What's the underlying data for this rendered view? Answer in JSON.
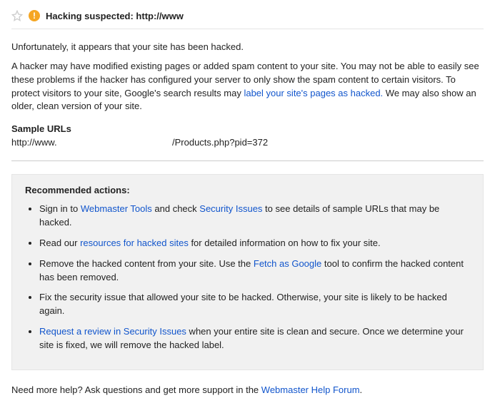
{
  "header": {
    "title": "Hacking suspected: http://www"
  },
  "intro": "Unfortunately, it appears that your site has been hacked.",
  "body": {
    "part1": "A hacker may have modified existing pages or added spam content to your site. You may not be able to easily see these problems if the hacker has configured your server to only show the spam content to certain visitors. To protect visitors to your site, Google's search results may ",
    "link1": "label your site's pages as hacked.",
    "part2": " We may also show an older, clean version of your site."
  },
  "sample": {
    "heading": "Sample URLs",
    "host": "http://www.",
    "path": "/Products.php?pid=372"
  },
  "rec": {
    "heading": "Recommended actions:",
    "items": {
      "i1a": "Sign in to ",
      "i1l1": "Webmaster Tools",
      "i1b": " and check ",
      "i1l2": "Security Issues",
      "i1c": " to see details of sample URLs that may be hacked.",
      "i2a": "Read our ",
      "i2l1": "resources for hacked sites",
      "i2b": " for detailed information on how to fix your site.",
      "i3a": "Remove the hacked content from your site. Use the ",
      "i3l1": "Fetch as Google",
      "i3b": " tool to confirm the hacked content has been removed.",
      "i4": "Fix the security issue that allowed your site to be hacked. Otherwise, your site is likely to be hacked again.",
      "i5l1": "Request a review in Security Issues",
      "i5a": " when your entire site is clean and secure. Once we determine your site is fixed, we will remove the hacked label."
    }
  },
  "footer": {
    "text": "Need more help? Ask questions and get more support in the ",
    "link": "Webmaster Help Forum",
    "end": "."
  }
}
